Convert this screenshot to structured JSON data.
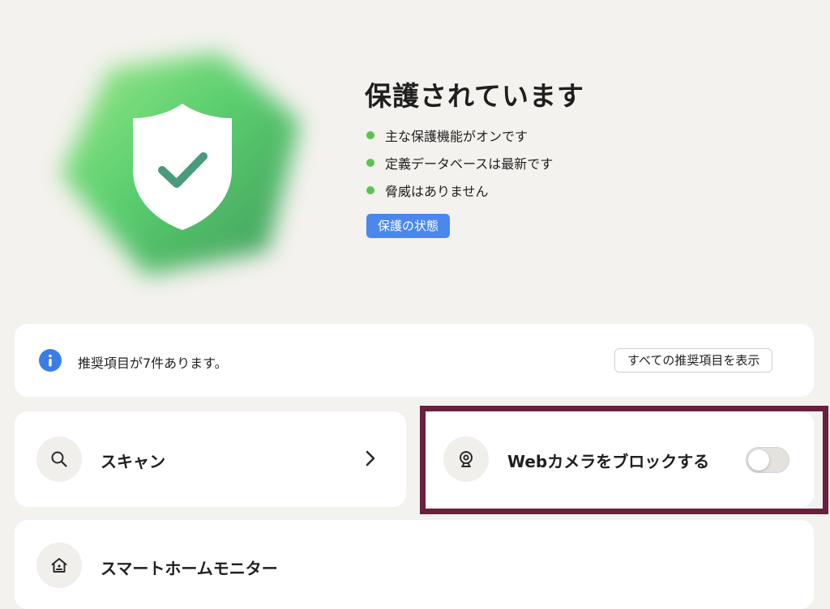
{
  "hero": {
    "title": "保護されています",
    "status_items": [
      {
        "text": "主な保護機能がオンです"
      },
      {
        "text": "定義データベースは最新です"
      },
      {
        "text": "脅威はありません"
      }
    ],
    "protection_status_button": "保護の状態",
    "icon": "shield-check-icon"
  },
  "recommendations": {
    "text": "推奨項目が7件あります。",
    "show_all_button": "すべての推奨項目を表示",
    "icon": "info-icon"
  },
  "cards": {
    "scan": {
      "label": "スキャン",
      "icon": "search-icon"
    },
    "webcam": {
      "label": "Webカメラをブロックする",
      "icon": "webcam-icon",
      "toggle_on": false
    },
    "smart_home": {
      "label": "スマートホームモニター",
      "icon": "home-icon"
    }
  },
  "colors": {
    "background": "#f4f2ee",
    "accent_blue": "#4a88ee",
    "status_green": "#5ac44e",
    "highlight_frame": "#6a1f3d"
  }
}
